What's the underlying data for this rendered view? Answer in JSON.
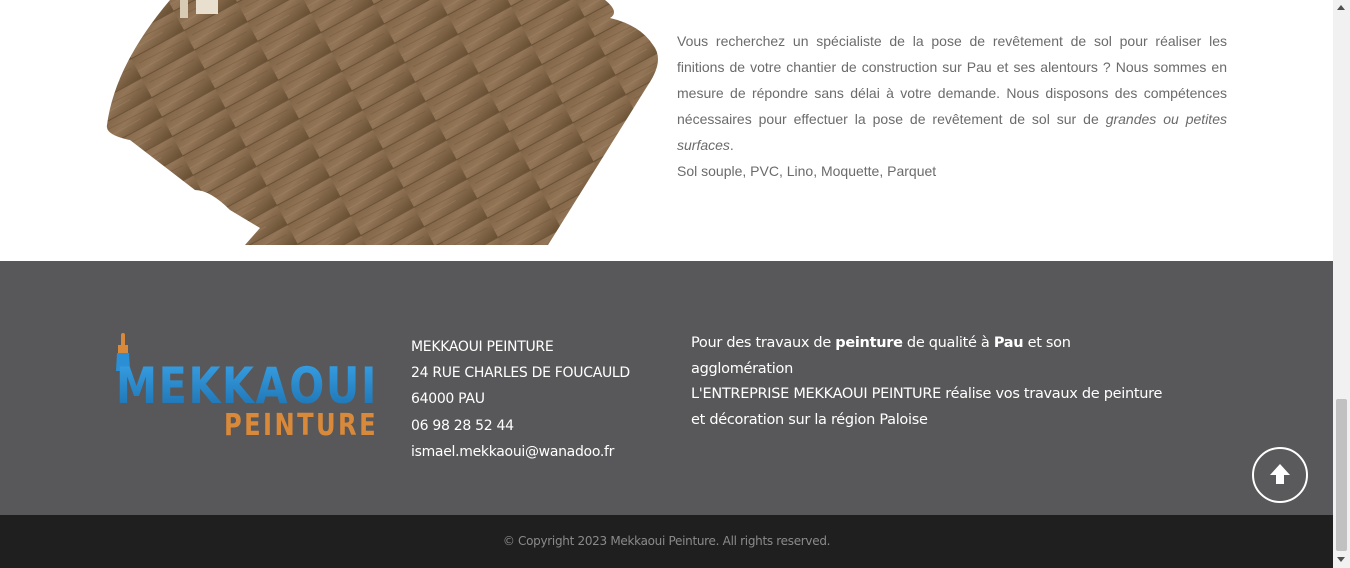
{
  "content": {
    "description_part1": "Vous recherchez un spécialiste de la pose de revêtement de sol pour réaliser les finitions de votre chantier de construction sur Pau et ses alentours ? Nous sommes en mesure de répondre sans délai à votre demande. Nous disposons des compétences nécessaires pour effectuer la pose de revêtement de sol sur de ",
    "description_emphasis": "grandes ou petites surfaces",
    "description_end": ".",
    "floor_types": "Sol souple, PVC, Lino, Moquette, Parquet"
  },
  "footer": {
    "logo": {
      "line1": "MEKKAOUI",
      "line2": "PEINTURE"
    },
    "address": {
      "company": "MEKKAOUI PEINTURE",
      "street": "24 RUE CHARLES DE FOUCAULD",
      "city": "64000 PAU",
      "phone": "06 98 28 52 44",
      "email": "ismael.mekkaoui@wanadoo.fr"
    },
    "about": {
      "t1": "Pour des travaux de ",
      "b1": "peinture",
      "t2": " de qualité à ",
      "b2": "Pau",
      "t3": " et son agglomération",
      "line2": "L'ENTREPRISE MEKKAOUI PEINTURE réalise vos travaux de peinture et décoration sur la région Paloise"
    },
    "copyright": "© Copyright 2023 Mekkaoui Peinture. All rights reserved."
  },
  "icons": {
    "scroll_top": "arrow-up-icon"
  },
  "colors": {
    "footer_bg": "#58585a",
    "bottombar_bg": "#1f1f1f",
    "logo_blue": "#2b8fd6",
    "logo_orange": "#d9893a"
  }
}
